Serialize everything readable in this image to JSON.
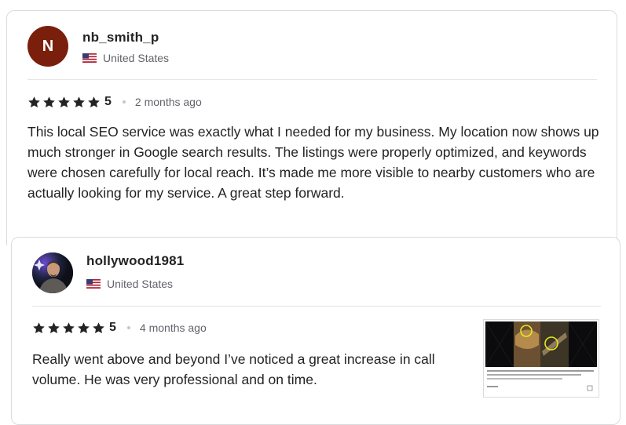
{
  "reviews": [
    {
      "avatar_letter": "N",
      "avatar_color": "#7a1f0c",
      "username": "nb_smith_p",
      "country": "United States",
      "rating": "5",
      "time_ago": "2 months ago",
      "text": "This local SEO service was exactly what I needed for my business. My location now shows up much stronger in Google search results. The listings were properly optimized, and keywords were chosen carefully for local reach. It’s made me more visible to nearby customers who are actually looking for my service. A great step forward."
    },
    {
      "avatar_icon": "user-photo",
      "username": "hollywood1981",
      "country": "United States",
      "rating": "5",
      "time_ago": "4 months ago",
      "text": "Really went above and beyond I’ve noticed a great increase in call volume. He was very professional and on time.",
      "attachment_icon": "review-attachment-thumbnail"
    }
  ]
}
